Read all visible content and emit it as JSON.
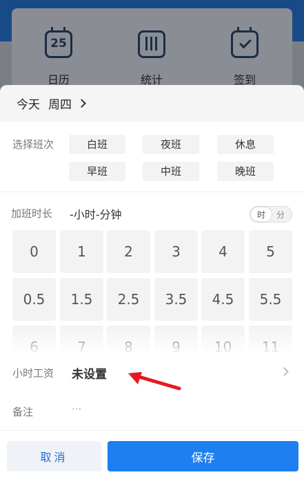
{
  "background": {
    "tools": [
      {
        "label": "日历",
        "icon": "calendar-icon",
        "number": "25"
      },
      {
        "label": "统计",
        "icon": "bar-chart-icon"
      },
      {
        "label": "签到",
        "icon": "check-in-icon"
      }
    ]
  },
  "sheet": {
    "date_today": "今天",
    "date_weekday": "周四",
    "shift": {
      "label": "选择班次",
      "options": [
        "白班",
        "夜班",
        "休息",
        "早班",
        "中班",
        "晚班"
      ]
    },
    "overtime": {
      "label": "加班时长",
      "value": "-小时-分钟",
      "toggle_hour": "时",
      "toggle_minute": "分"
    },
    "keypad": [
      "0",
      "1",
      "2",
      "3",
      "4",
      "5",
      "0.5",
      "1.5",
      "2.5",
      "3.5",
      "4.5",
      "5.5",
      "6",
      "7",
      "8",
      "9",
      "10",
      "11"
    ],
    "wage": {
      "label": "小时工资",
      "value": "未设置"
    },
    "note": {
      "label": "备注",
      "placeholder": "···"
    },
    "buttons": {
      "cancel": "取消",
      "save": "保存"
    }
  },
  "colors": {
    "accent": "#1e7ff0",
    "annotation_arrow": "#e8191e"
  }
}
